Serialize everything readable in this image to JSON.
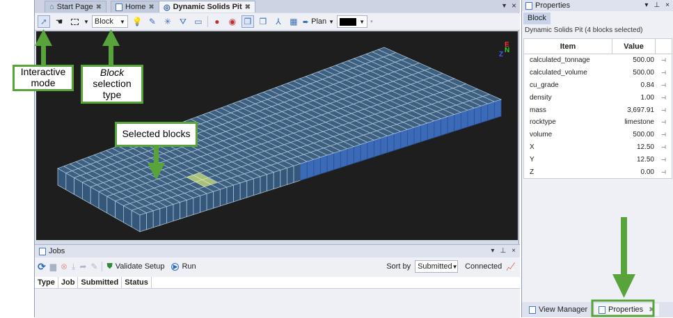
{
  "tabs": [
    {
      "label": "Start Page",
      "icon": "home-icon",
      "active": false
    },
    {
      "label": "Home",
      "icon": "document-icon",
      "active": false
    },
    {
      "label": "Dynamic Solids Pit",
      "icon": "pit-icon",
      "active": true
    }
  ],
  "toolbar": {
    "selection_type": "Block",
    "plan_label": "Plan",
    "color_swatch": "#000000"
  },
  "annotations": {
    "interactive_mode": "Interactive mode",
    "block_word": "Block",
    "block_rest": "selection type",
    "selected_blocks": "Selected blocks",
    "accent_color": "#58a33a"
  },
  "jobs": {
    "title": "Jobs",
    "validate_label": "Validate Setup",
    "run_label": "Run",
    "sort_by_label": "Sort by",
    "sort_value": "Submitted",
    "status_text": "Connected",
    "columns": [
      "Type",
      "Job",
      "Submitted",
      "Status"
    ]
  },
  "properties": {
    "title": "Properties",
    "tab": "Block",
    "subtitle": "Dynamic Solids Pit (4 blocks selected)",
    "headers": {
      "item": "Item",
      "value": "Value"
    },
    "rows": [
      {
        "item": "calculated_tonnage",
        "value": "500.00"
      },
      {
        "item": "calculated_volume",
        "value": "500.00"
      },
      {
        "item": "cu_grade",
        "value": "0.84"
      },
      {
        "item": "density",
        "value": "1.00"
      },
      {
        "item": "mass",
        "value": "3,697.91"
      },
      {
        "item": "rocktype",
        "value": "limestone"
      },
      {
        "item": "volume",
        "value": "500.00"
      },
      {
        "item": "X",
        "value": "12.50"
      },
      {
        "item": "Y",
        "value": "12.50"
      },
      {
        "item": "Z",
        "value": "0.00"
      }
    ],
    "bottom_tabs": [
      {
        "label": "View Manager",
        "active": false
      },
      {
        "label": "Properties",
        "active": true
      }
    ]
  },
  "axis": {
    "e": "E",
    "n": "N",
    "z": "Z"
  },
  "colors": {
    "block_fill": "#3d5f80",
    "block_edge": "#a9c2d8",
    "selected": "#a8c07a",
    "side_face": "#3a6ab8"
  }
}
